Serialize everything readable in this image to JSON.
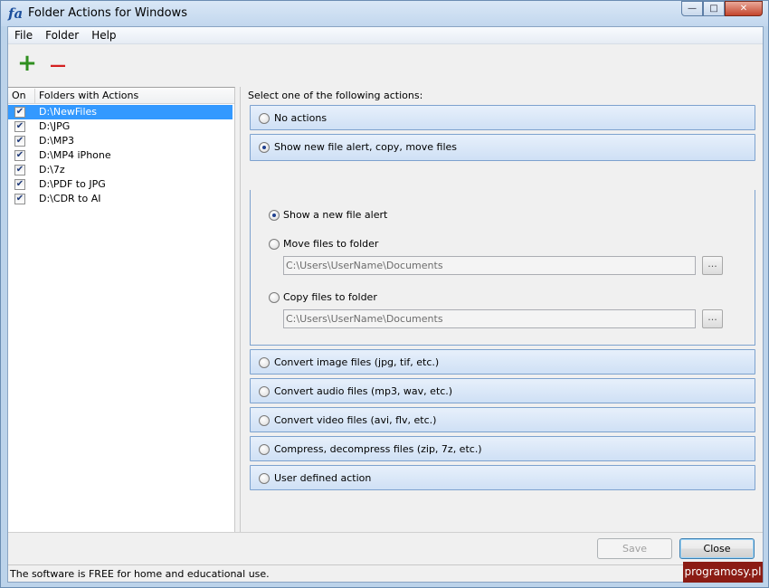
{
  "window": {
    "icon": "fa",
    "title": "Folder Actions for Windows",
    "minimize": "—",
    "maximize": "□",
    "close": "✕"
  },
  "menu": [
    "File",
    "Folder",
    "Help"
  ],
  "toolbar": {
    "add_icon": "+",
    "remove_icon": "—"
  },
  "folder_list": {
    "col_on": "On",
    "col_folders": "Folders with Actions",
    "rows": [
      {
        "on": true,
        "path": "D:\\NewFiles",
        "selected": true
      },
      {
        "on": true,
        "path": "D:\\JPG",
        "selected": false
      },
      {
        "on": true,
        "path": "D:\\MP3",
        "selected": false
      },
      {
        "on": true,
        "path": "D:\\MP4 iPhone",
        "selected": false
      },
      {
        "on": true,
        "path": "D:\\7z",
        "selected": false
      },
      {
        "on": true,
        "path": "D:\\PDF to JPG",
        "selected": false
      },
      {
        "on": true,
        "path": "D:\\CDR to AI",
        "selected": false
      }
    ]
  },
  "actions": {
    "instruction": "Select one of the following actions:",
    "no_actions": "No actions",
    "alert_copy_move": "Show new file alert, copy, move files",
    "sub": {
      "show_alert": "Show a new file alert",
      "move_to": "Move files to folder",
      "move_path": "C:\\Users\\UserName\\Documents",
      "copy_to": "Copy files to folder",
      "copy_path": "C:\\Users\\UserName\\Documents",
      "browse": "..."
    },
    "convert_image": "Convert image files (jpg, tif, etc.)",
    "convert_audio": "Convert audio files (mp3, wav, etc.)",
    "convert_video": "Convert video files (avi, flv, etc.)",
    "compress": "Compress, decompress files (zip, 7z, etc.)",
    "user_defined": "User defined action"
  },
  "buttons": {
    "save": "Save",
    "close": "Close"
  },
  "status": "The software is FREE for home and educational use.",
  "watermark": "programosy.pl"
}
